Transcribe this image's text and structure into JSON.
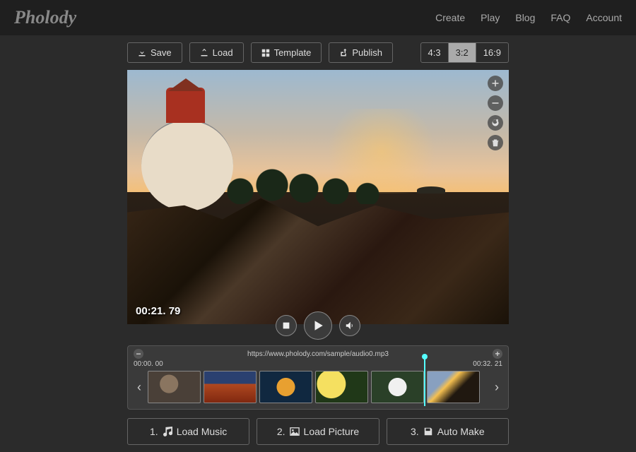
{
  "brand": "Pholody",
  "nav": {
    "create": "Create",
    "play": "Play",
    "blog": "Blog",
    "faq": "FAQ",
    "account": "Account"
  },
  "toolbar": {
    "save": "Save",
    "load": "Load",
    "template": "Template",
    "publish": "Publish"
  },
  "ratios": {
    "r43": "4:3",
    "r32": "3:2",
    "r169": "16:9",
    "selected": "3:2"
  },
  "side_controls": {
    "zoom_in": "zoom-in",
    "zoom_out": "zoom-out",
    "refresh": "refresh",
    "delete": "delete"
  },
  "player": {
    "timestamp": "00:21. 79",
    "stop": "stop",
    "play": "play",
    "mute": "mute"
  },
  "timeline": {
    "audio_url": "https://www.pholody.com/sample/audio0.mp3",
    "start": "00:00. 00",
    "end": "00:32. 21",
    "zoom_out": "−",
    "zoom_in": "+",
    "thumbs": [
      "koala",
      "canyon",
      "jellyfish",
      "flowers-yellow",
      "flowers-white",
      "lighthouse"
    ]
  },
  "steps": {
    "music_prefix": "1. ",
    "music": "Load Music",
    "picture_prefix": "2. ",
    "picture": "Load Picture",
    "auto_prefix": "3. ",
    "auto": "Auto Make"
  }
}
